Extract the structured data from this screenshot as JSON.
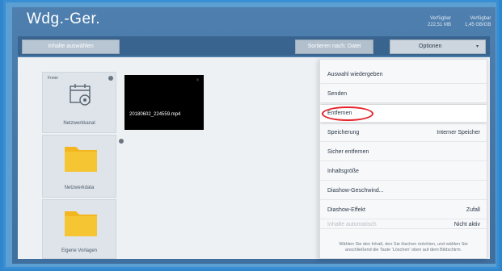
{
  "header": {
    "title": "Wdg.-Ger.",
    "storage_left_label": "Verfügbar",
    "storage_left_value": "222,51 MB",
    "storage_right_label": "Verfügbar",
    "storage_right_value": "1,45 GB/GB"
  },
  "toolbar": {
    "left_button": "Inhalte auswählen",
    "right_button": "Sortieren nach: Datei",
    "options_button": "Optionen",
    "options_caret": "▾"
  },
  "tiles": [
    {
      "label": "Netzwerkkanal",
      "corner": "Freier"
    },
    {
      "label": "Netzwerkdata"
    },
    {
      "label": "Eigene Vorlagen"
    }
  ],
  "video": {
    "filename": "20180602_224559.mp4",
    "close": "✕"
  },
  "menu": {
    "items": [
      {
        "label": "Auswahl wiedergeben",
        "value": ""
      },
      {
        "label": "Senden",
        "value": ""
      },
      {
        "label": "Entfernen",
        "value": ""
      },
      {
        "label": "Speicherung",
        "value": "Interner Speicher"
      },
      {
        "label": "Sicher entfernen",
        "value": ""
      },
      {
        "label": "Inhaltsgröße",
        "value": ""
      },
      {
        "label": "Diashow-Geschwind...",
        "value": ""
      },
      {
        "label": "Diashow-Effekt",
        "value": "Zufall"
      },
      {
        "label": "Inhalte automatisch",
        "value": "Nicht aktiv"
      }
    ],
    "help_text": "Wählen Sie den Inhalt, den Sie löschen möchten, und wählen Sie anschließend die Taste 'Löschen' oben auf dem Bildschirm."
  },
  "colors": {
    "highlight_oval": "#e4222a",
    "background": "#4e7fae"
  }
}
